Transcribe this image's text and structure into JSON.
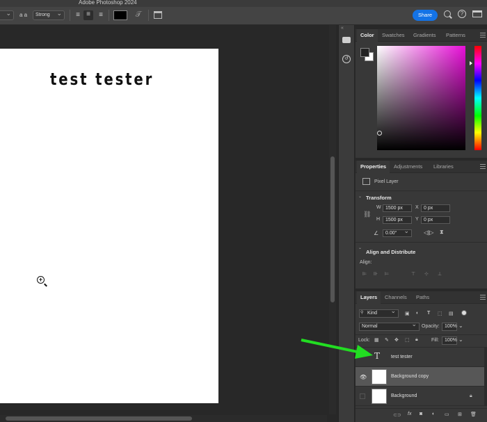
{
  "app": {
    "title": "Adobe Photoshop 2024"
  },
  "options_bar": {
    "aa_label": "a a",
    "antialias": "Strong",
    "share_label": "Share"
  },
  "canvas": {
    "text": "test tester"
  },
  "color_panel": {
    "tabs": [
      "Color",
      "Swatches",
      "Gradients",
      "Patterns"
    ]
  },
  "properties_panel": {
    "tabs": [
      "Properties",
      "Adjustments",
      "Libraries"
    ],
    "layer_type": "Pixel Layer",
    "transform": {
      "title": "Transform",
      "w_label": "W",
      "w": "1500 px",
      "h_label": "H",
      "h": "1500 px",
      "x_label": "X",
      "x": "0 px",
      "y_label": "Y",
      "y": "0 px",
      "angle": "0.00°"
    },
    "align": {
      "title": "Align and Distribute",
      "label": "Align:"
    }
  },
  "layers_panel": {
    "tabs": [
      "Layers",
      "Channels",
      "Paths"
    ],
    "kind": "Kind",
    "blend_mode": "Normal",
    "opacity_label": "Opacity:",
    "opacity": "100%",
    "lock_label": "Lock:",
    "fill_label": "Fill:",
    "fill": "100%",
    "layers": [
      {
        "name": "test tester",
        "type": "text"
      },
      {
        "name": "Background copy",
        "type": "pixel",
        "visible": true,
        "selected": true
      },
      {
        "name": "Background",
        "type": "pixel",
        "locked": true
      }
    ]
  },
  "annotation": {
    "arrow_color": "#22dd22"
  }
}
